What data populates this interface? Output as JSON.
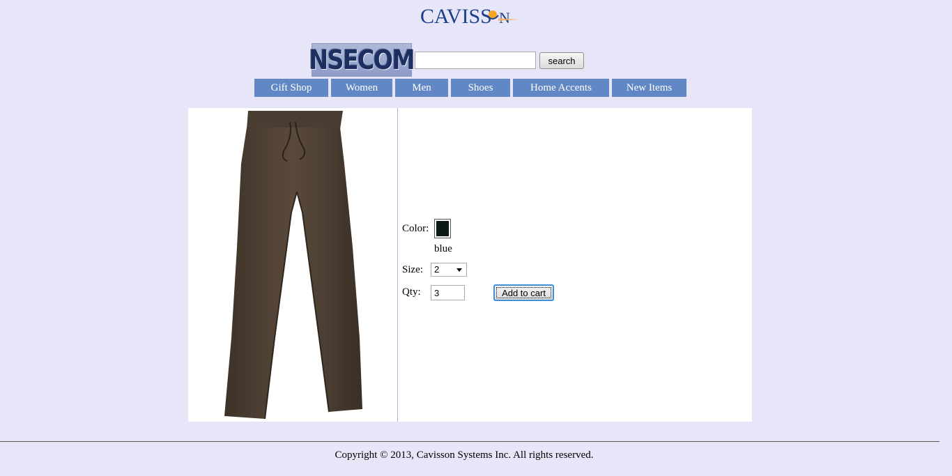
{
  "brand": {
    "top_logo_text": "Cavisson",
    "store_logo_text": "NSECOM"
  },
  "search": {
    "value": "",
    "placeholder": "",
    "button_label": "search"
  },
  "nav": {
    "items": [
      {
        "label": "Gift Shop"
      },
      {
        "label": "Women"
      },
      {
        "label": "Men"
      },
      {
        "label": "Shoes"
      },
      {
        "label": "Home Accents"
      },
      {
        "label": "New Items"
      }
    ]
  },
  "product": {
    "image_icon": "brown-pants-image",
    "color_label": "Color:",
    "color_swatch_hex": "#0b1a17",
    "color_name": "blue",
    "size_label": "Size:",
    "size_selected": "2",
    "qty_label": "Qty:",
    "qty_value": "3",
    "add_to_cart_label": "Add to cart"
  },
  "footer": {
    "copyright": "Copyright © 2013, Cavisson Systems Inc. All rights reserved."
  },
  "colors": {
    "page_background": "#e6e6f8",
    "nav_background": "#6187c5",
    "nav_text": "#ffffff",
    "logo_blue": "#1b3f8c"
  }
}
